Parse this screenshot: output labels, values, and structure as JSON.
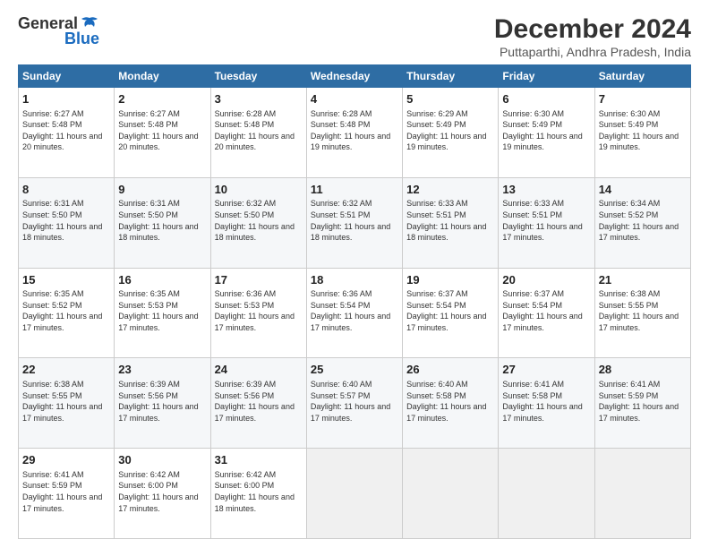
{
  "header": {
    "logo_general": "General",
    "logo_blue": "Blue",
    "title": "December 2024",
    "subtitle": "Puttaparthi, Andhra Pradesh, India"
  },
  "calendar": {
    "headers": [
      "Sunday",
      "Monday",
      "Tuesday",
      "Wednesday",
      "Thursday",
      "Friday",
      "Saturday"
    ],
    "weeks": [
      [
        {
          "day": "1",
          "sunrise": "6:27 AM",
          "sunset": "5:48 PM",
          "daylight": "11 hours and 20 minutes."
        },
        {
          "day": "2",
          "sunrise": "6:27 AM",
          "sunset": "5:48 PM",
          "daylight": "11 hours and 20 minutes."
        },
        {
          "day": "3",
          "sunrise": "6:28 AM",
          "sunset": "5:48 PM",
          "daylight": "11 hours and 20 minutes."
        },
        {
          "day": "4",
          "sunrise": "6:28 AM",
          "sunset": "5:48 PM",
          "daylight": "11 hours and 19 minutes."
        },
        {
          "day": "5",
          "sunrise": "6:29 AM",
          "sunset": "5:49 PM",
          "daylight": "11 hours and 19 minutes."
        },
        {
          "day": "6",
          "sunrise": "6:30 AM",
          "sunset": "5:49 PM",
          "daylight": "11 hours and 19 minutes."
        },
        {
          "day": "7",
          "sunrise": "6:30 AM",
          "sunset": "5:49 PM",
          "daylight": "11 hours and 19 minutes."
        }
      ],
      [
        {
          "day": "8",
          "sunrise": "6:31 AM",
          "sunset": "5:50 PM",
          "daylight": "11 hours and 18 minutes."
        },
        {
          "day": "9",
          "sunrise": "6:31 AM",
          "sunset": "5:50 PM",
          "daylight": "11 hours and 18 minutes."
        },
        {
          "day": "10",
          "sunrise": "6:32 AM",
          "sunset": "5:50 PM",
          "daylight": "11 hours and 18 minutes."
        },
        {
          "day": "11",
          "sunrise": "6:32 AM",
          "sunset": "5:51 PM",
          "daylight": "11 hours and 18 minutes."
        },
        {
          "day": "12",
          "sunrise": "6:33 AM",
          "sunset": "5:51 PM",
          "daylight": "11 hours and 18 minutes."
        },
        {
          "day": "13",
          "sunrise": "6:33 AM",
          "sunset": "5:51 PM",
          "daylight": "11 hours and 17 minutes."
        },
        {
          "day": "14",
          "sunrise": "6:34 AM",
          "sunset": "5:52 PM",
          "daylight": "11 hours and 17 minutes."
        }
      ],
      [
        {
          "day": "15",
          "sunrise": "6:35 AM",
          "sunset": "5:52 PM",
          "daylight": "11 hours and 17 minutes."
        },
        {
          "day": "16",
          "sunrise": "6:35 AM",
          "sunset": "5:53 PM",
          "daylight": "11 hours and 17 minutes."
        },
        {
          "day": "17",
          "sunrise": "6:36 AM",
          "sunset": "5:53 PM",
          "daylight": "11 hours and 17 minutes."
        },
        {
          "day": "18",
          "sunrise": "6:36 AM",
          "sunset": "5:54 PM",
          "daylight": "11 hours and 17 minutes."
        },
        {
          "day": "19",
          "sunrise": "6:37 AM",
          "sunset": "5:54 PM",
          "daylight": "11 hours and 17 minutes."
        },
        {
          "day": "20",
          "sunrise": "6:37 AM",
          "sunset": "5:54 PM",
          "daylight": "11 hours and 17 minutes."
        },
        {
          "day": "21",
          "sunrise": "6:38 AM",
          "sunset": "5:55 PM",
          "daylight": "11 hours and 17 minutes."
        }
      ],
      [
        {
          "day": "22",
          "sunrise": "6:38 AM",
          "sunset": "5:55 PM",
          "daylight": "11 hours and 17 minutes."
        },
        {
          "day": "23",
          "sunrise": "6:39 AM",
          "sunset": "5:56 PM",
          "daylight": "11 hours and 17 minutes."
        },
        {
          "day": "24",
          "sunrise": "6:39 AM",
          "sunset": "5:56 PM",
          "daylight": "11 hours and 17 minutes."
        },
        {
          "day": "25",
          "sunrise": "6:40 AM",
          "sunset": "5:57 PM",
          "daylight": "11 hours and 17 minutes."
        },
        {
          "day": "26",
          "sunrise": "6:40 AM",
          "sunset": "5:58 PM",
          "daylight": "11 hours and 17 minutes."
        },
        {
          "day": "27",
          "sunrise": "6:41 AM",
          "sunset": "5:58 PM",
          "daylight": "11 hours and 17 minutes."
        },
        {
          "day": "28",
          "sunrise": "6:41 AM",
          "sunset": "5:59 PM",
          "daylight": "11 hours and 17 minutes."
        }
      ],
      [
        {
          "day": "29",
          "sunrise": "6:41 AM",
          "sunset": "5:59 PM",
          "daylight": "11 hours and 17 minutes."
        },
        {
          "day": "30",
          "sunrise": "6:42 AM",
          "sunset": "6:00 PM",
          "daylight": "11 hours and 17 minutes."
        },
        {
          "day": "31",
          "sunrise": "6:42 AM",
          "sunset": "6:00 PM",
          "daylight": "11 hours and 18 minutes."
        },
        null,
        null,
        null,
        null
      ]
    ]
  }
}
